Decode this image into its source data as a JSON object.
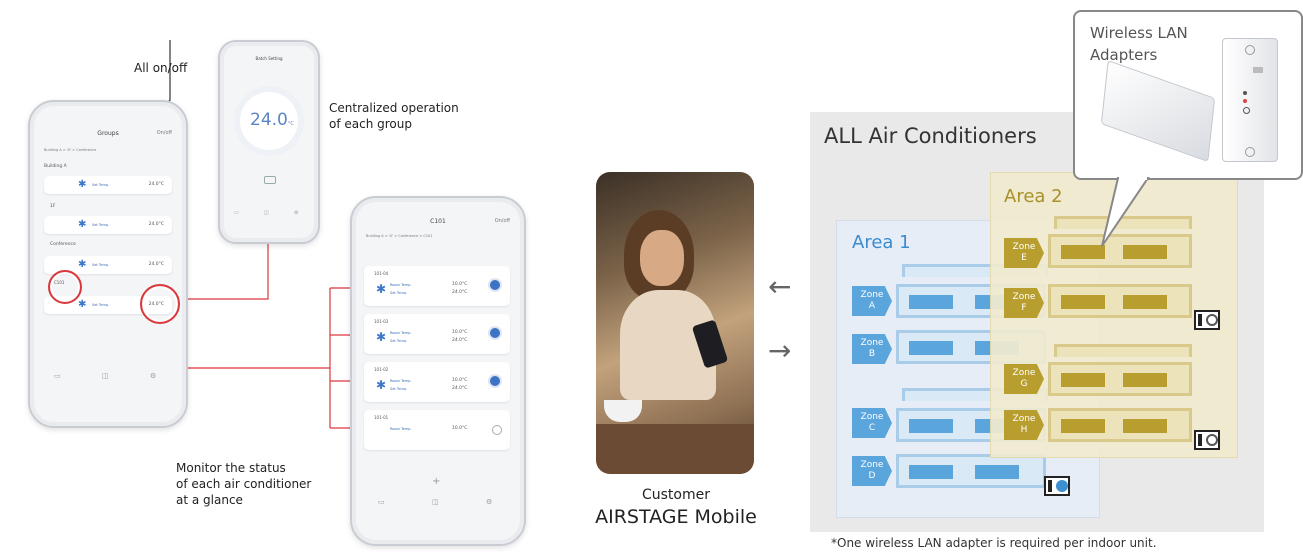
{
  "callouts": {
    "all_onoff": "All on/off",
    "centralized": [
      "Centralized operation",
      "of each group"
    ],
    "monitor": [
      "Monitor the status",
      "of each air conditioner",
      "at a glance"
    ]
  },
  "phone_groups": {
    "title": "Groups",
    "toggle": "On/off",
    "breadcrumb": "Building A  >  1F  >  Conference",
    "sections": [
      "Building A",
      "1F",
      "Conference"
    ],
    "rows": [
      {
        "label": "Set Temp.",
        "value": "24.0°C"
      },
      {
        "label": "Set Temp.",
        "value": "24.0°C"
      },
      {
        "label": "Set Temp.",
        "value": "24.0°C"
      },
      {
        "label": "Set Temp.",
        "value": "24.0°C"
      }
    ],
    "group_tag": "C101"
  },
  "phone_small": {
    "title": "Batch Setting",
    "temp": "24.0",
    "unit": "°C"
  },
  "phone_c101": {
    "title": "C101",
    "toggle": "On/off",
    "breadcrumb": "Building A  >  1F  >  Conference  >  C101",
    "units": [
      {
        "name": "101-04",
        "room_label": "Room Temp.",
        "room": "10.0°C",
        "set_label": "Set Temp.",
        "set": "24.0°C",
        "on": true
      },
      {
        "name": "101-03",
        "room_label": "Room Temp.",
        "room": "10.0°C",
        "set_label": "Set Temp.",
        "set": "24.0°C",
        "on": true
      },
      {
        "name": "101-02",
        "room_label": "Room Temp.",
        "room": "10.0°C",
        "set_label": "Set Temp.",
        "set": "24.0°C",
        "on": true
      },
      {
        "name": "101-01",
        "room_label": "Room Temp.",
        "room": "10.0°C",
        "set_label": "",
        "set": "",
        "on": false
      }
    ],
    "add": "+"
  },
  "center": {
    "caption_line1": "Customer",
    "caption_line2": "AIRSTAGE Mobile",
    "arrow_left": "←",
    "arrow_right": "→"
  },
  "diagram": {
    "all_title": "ALL Air Conditioners",
    "area1": "Area 1",
    "area2": "Area 2",
    "zones_area1": [
      [
        "Zone",
        "A"
      ],
      [
        "Zone",
        "B"
      ],
      [
        "Zone",
        "C"
      ],
      [
        "Zone",
        "D"
      ]
    ],
    "zones_area2": [
      [
        "Zone",
        "E"
      ],
      [
        "Zone",
        "F"
      ],
      [
        "Zone",
        "G"
      ],
      [
        "Zone",
        "H"
      ]
    ],
    "adapter_title": [
      "Wireless LAN",
      "Adapters"
    ],
    "footnote": "*One wireless LAN adapter is required per indoor unit."
  },
  "colors": {
    "accent_red": "#d9383d",
    "blue": "#5aa6dc",
    "gold": "#b89e2f"
  }
}
